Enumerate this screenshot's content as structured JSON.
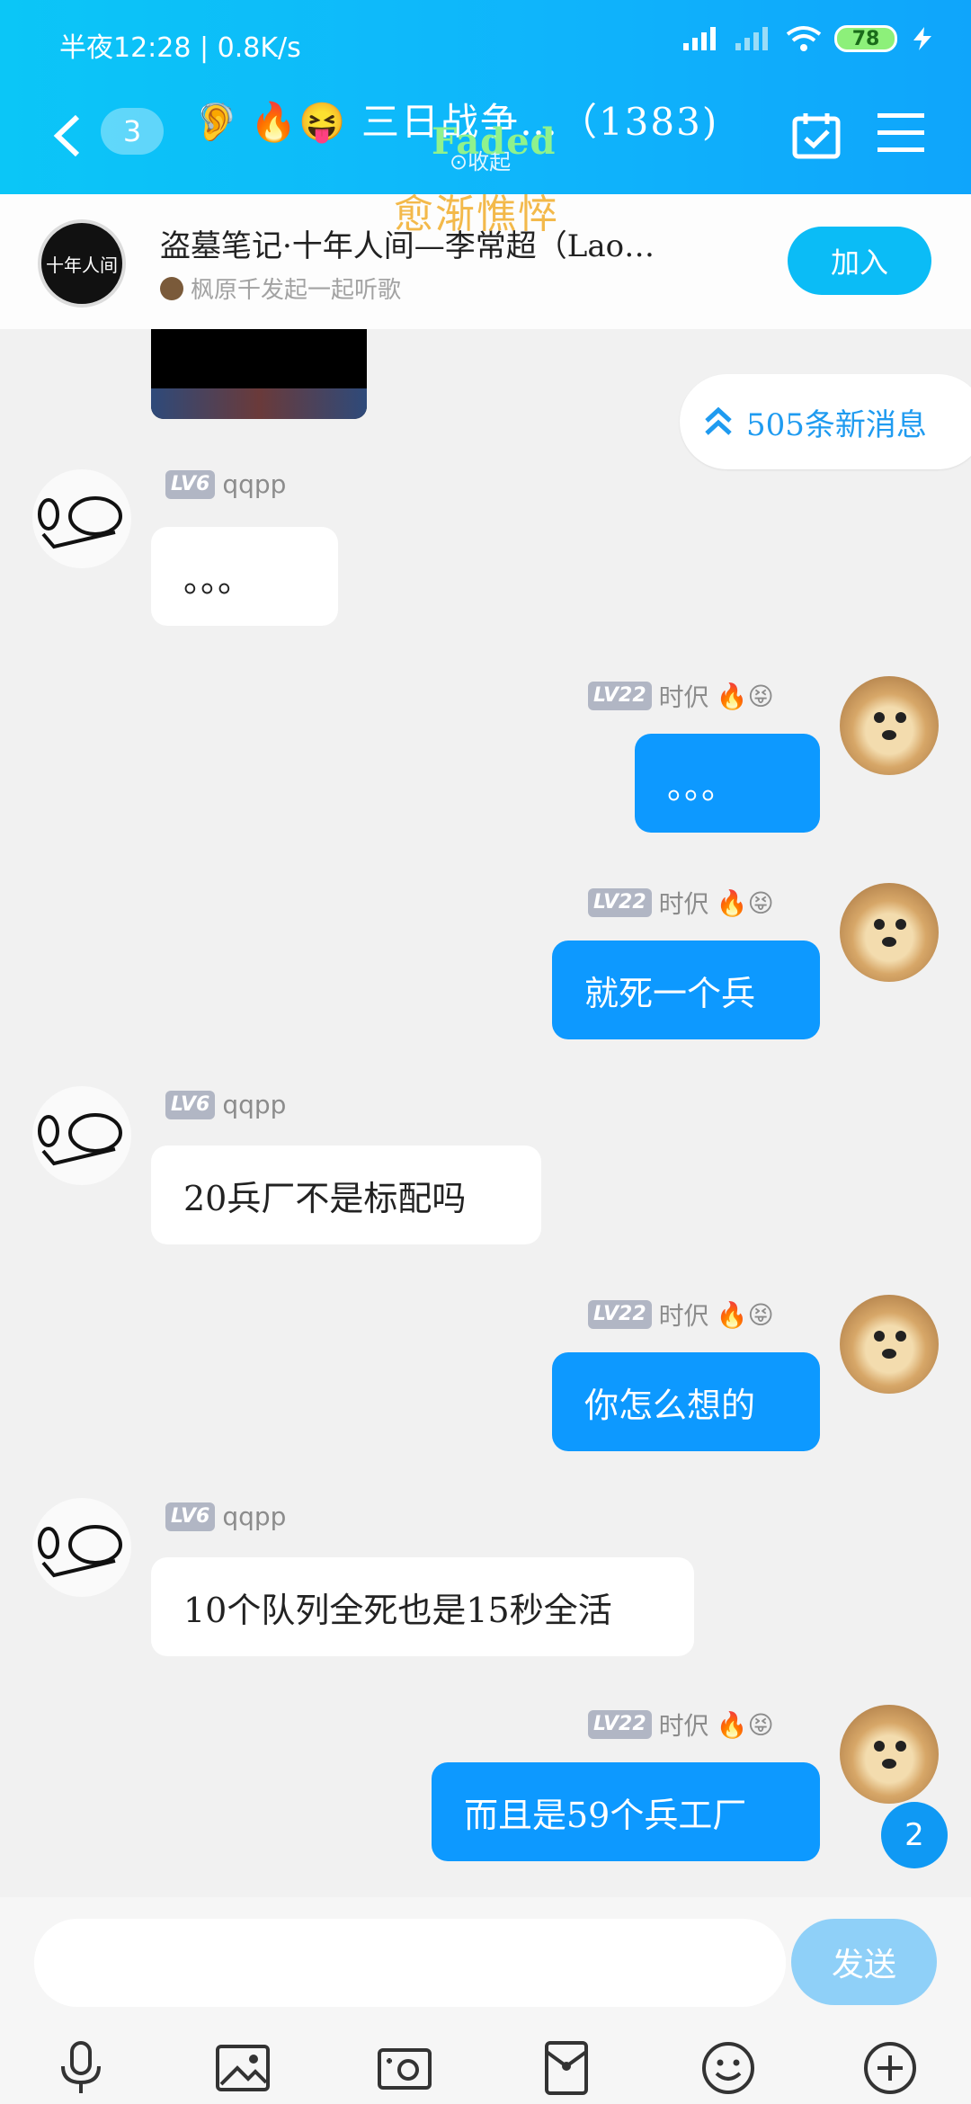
{
  "status": {
    "time": "半夜12:28",
    "speed": "0.8K/s",
    "battery": "78"
  },
  "header": {
    "back_count": "3",
    "emojis": "🔥😝",
    "title": "三日战争…（1383)",
    "overlay_faded": "Faded",
    "overlay_collapse": "⊙收起",
    "overlay_yujian": "愈渐憔悴"
  },
  "music": {
    "song": "盗墓笔记·十年人间—李常超（Lao…",
    "sub": "枫原千发起一起听歌",
    "join": "加入",
    "cover_text": "十年人间"
  },
  "chat": {
    "new_messages": "505条新消息",
    "messages": [
      {
        "side": "left",
        "level": "LV6",
        "name": "qqpp",
        "text": "。。。"
      },
      {
        "side": "right",
        "level": "LV22",
        "name": "时伬",
        "emojis": "🔥😝",
        "text": "。。。"
      },
      {
        "side": "right",
        "level": "LV22",
        "name": "时伬",
        "emojis": "🔥😝",
        "text": "就死一个兵"
      },
      {
        "side": "left",
        "level": "LV6",
        "name": "qqpp",
        "text": "20兵厂不是标配吗"
      },
      {
        "side": "right",
        "level": "LV22",
        "name": "时伬",
        "emojis": "🔥😝",
        "text": "你怎么想的"
      },
      {
        "side": "left",
        "level": "LV6",
        "name": "qqpp",
        "text": "10个队列全死也是15秒全活"
      },
      {
        "side": "right",
        "level": "LV22",
        "name": "时伬",
        "emojis": "🔥😝",
        "text": "而且是59个兵工厂"
      }
    ],
    "unread": "2"
  },
  "input": {
    "value": "",
    "send": "发送"
  },
  "icons": [
    "mic-icon",
    "image-icon",
    "camera-icon",
    "red-packet-icon",
    "emoji-icon",
    "plus-icon"
  ],
  "colors": {
    "accent": "#0d99ff",
    "header": "#0fb5fb"
  }
}
